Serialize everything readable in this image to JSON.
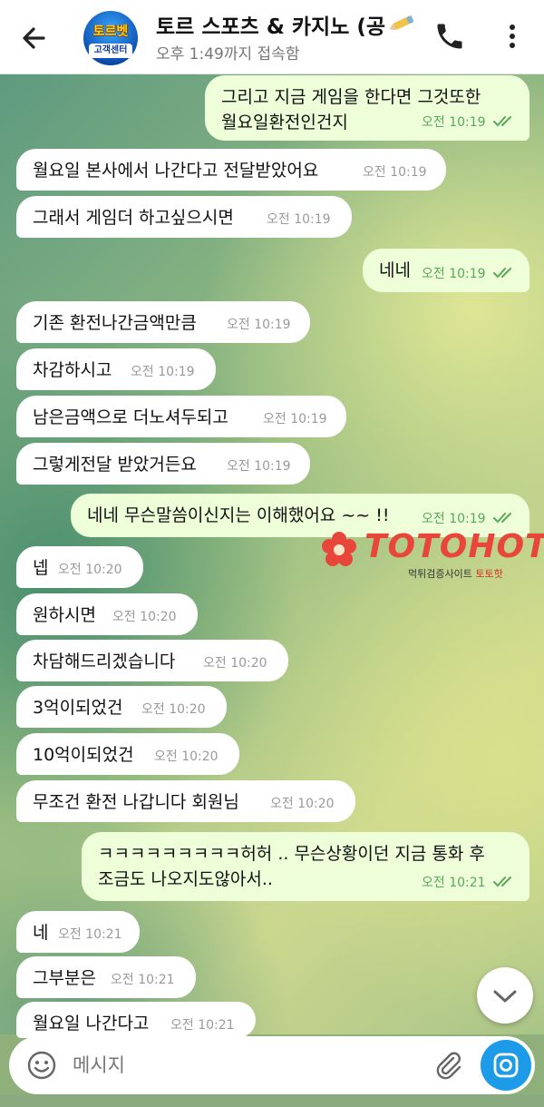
{
  "header": {
    "title": "토르 스포츠 & 카지노 (공",
    "status": "오후 1:49까지 접속함",
    "avatar_top": "토르벳",
    "avatar_bottom": "고객센터"
  },
  "messages": [
    {
      "dir": "out",
      "lines": [
        "그리고 지금 게임을 한다면 그것또한",
        "월요일환전인건지"
      ],
      "time": "오전 10:19"
    },
    {
      "dir": "in",
      "lines": [
        "월요일 본사에서 나간다고 전달받았어요"
      ],
      "time": "오전 10:19"
    },
    {
      "dir": "in",
      "lines": [
        "그래서 게임더 하고싶으시면"
      ],
      "time": "오전 10:19"
    },
    {
      "dir": "out",
      "lines": [
        "네네"
      ],
      "time": "오전 10:19"
    },
    {
      "dir": "in",
      "lines": [
        "기존 환전나간금액만큼"
      ],
      "time": "오전 10:19"
    },
    {
      "dir": "in",
      "lines": [
        "차감하시고"
      ],
      "time": "오전 10:19"
    },
    {
      "dir": "in",
      "lines": [
        "남은금액으로 더노셔두되고"
      ],
      "time": "오전 10:19"
    },
    {
      "dir": "in",
      "lines": [
        "그렇게전달 받았거든요"
      ],
      "time": "오전 10:19"
    },
    {
      "dir": "out",
      "lines": [
        "네네 무슨말씀이신지는 이해했어요 ~~ !!"
      ],
      "time": "오전 10:19"
    },
    {
      "dir": "in",
      "lines": [
        "넵"
      ],
      "time": "오전 10:20"
    },
    {
      "dir": "in",
      "lines": [
        "원하시면"
      ],
      "time": "오전 10:20"
    },
    {
      "dir": "in",
      "lines": [
        "차담해드리겠습니다"
      ],
      "time": "오전 10:20"
    },
    {
      "dir": "in",
      "lines": [
        "3억이되었건"
      ],
      "time": "오전 10:20"
    },
    {
      "dir": "in",
      "lines": [
        "10억이되었건"
      ],
      "time": "오전 10:20"
    },
    {
      "dir": "in",
      "lines": [
        "무조건 환전 나갑니다 회원님"
      ],
      "time": "오전 10:20"
    },
    {
      "dir": "out",
      "lines": [
        "ㅋㅋㅋㅋㅋㅋㅋㅋㅋ허허 .. 무슨상황이던 지금 통화 후",
        "조금도 나오지도않아서.."
      ],
      "time": "오전 10:21"
    },
    {
      "dir": "in",
      "lines": [
        "네"
      ],
      "time": "오전 10:21"
    },
    {
      "dir": "in",
      "lines": [
        "그부분은"
      ],
      "time": "오전 10:21"
    },
    {
      "dir": "in",
      "lines": [
        "월요일 나간다고"
      ],
      "time": "오전 10:21"
    }
  ],
  "watermark": {
    "brand": "TOTOHOT",
    "sub_prefix": "먹튀검증사이트",
    "sub_brand": "토토핫"
  },
  "input": {
    "placeholder": "메시지"
  },
  "icons": {
    "back": "arrow-left-icon",
    "call": "phone-icon",
    "menu": "more-vertical-icon",
    "emoji": "smiley-icon",
    "attach": "paperclip-icon",
    "camera": "camera-icon",
    "scroll": "chevron-down-icon",
    "read": "double-check-icon"
  },
  "colors": {
    "outgoing_bubble": "#eefed9",
    "incoming_bubble": "#ffffff",
    "read_check": "#5aa85a",
    "camera_button": "#1e9be8",
    "watermark": "#e8463a"
  }
}
